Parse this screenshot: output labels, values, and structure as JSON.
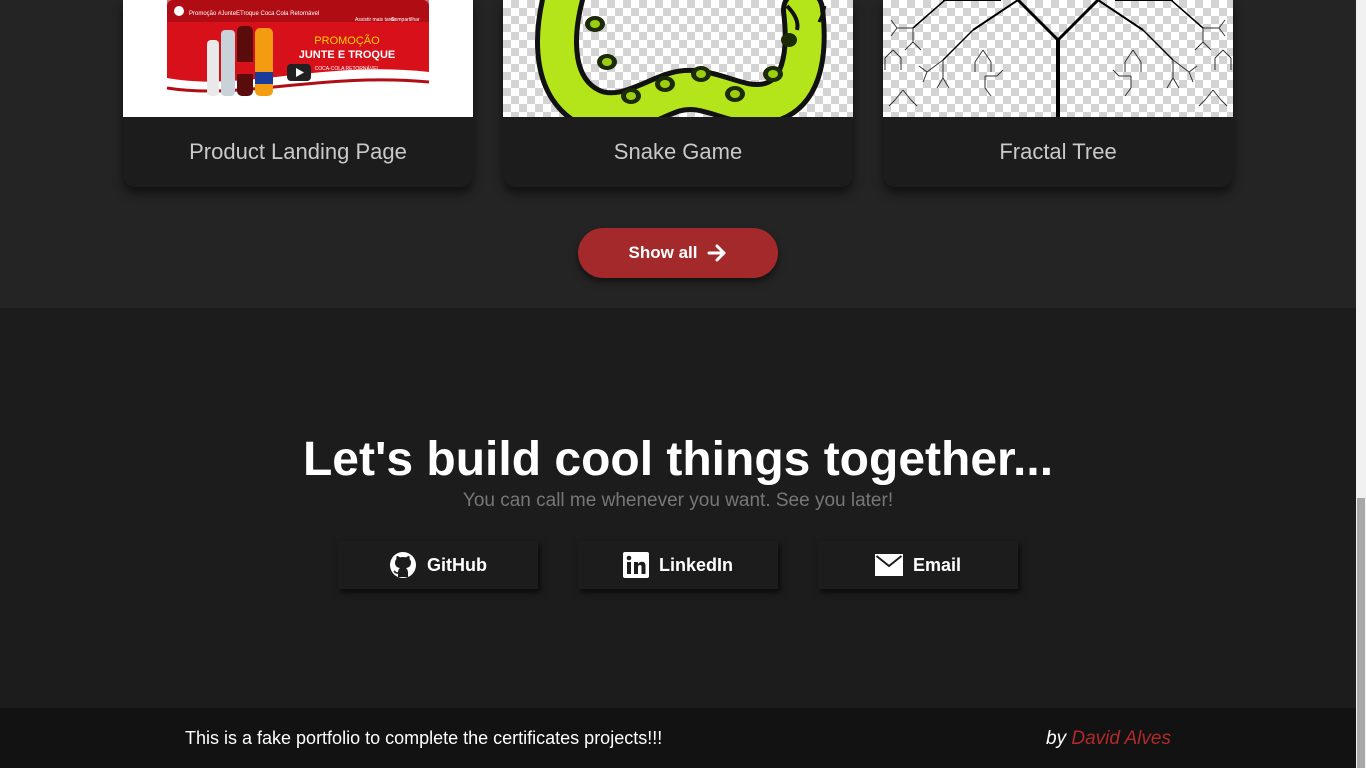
{
  "projects": {
    "cards": [
      {
        "title": "Product Landing Page",
        "thumb_channel": "Promoção #JunteETroque Coca Cola Retornável",
        "thumb_promo": "PROMOÇÃO",
        "thumb_headline": "JUNTE E TROQUE",
        "thumb_tagline": "COCA-COLA RETORNÁVEL",
        "thumb_watch_later": "Assistir mais tarde",
        "thumb_share": "Compartilhar"
      },
      {
        "title": "Snake Game"
      },
      {
        "title": "Fractal Tree"
      }
    ],
    "show_all_label": "Show all"
  },
  "contact": {
    "heading": "Let's build cool things together...",
    "subheading": "You can call me whenever you want. See you later!",
    "links": [
      {
        "label": "GitHub",
        "icon": "github-icon"
      },
      {
        "label": "LinkedIn",
        "icon": "linkedin-icon"
      },
      {
        "label": "Email",
        "icon": "email-icon"
      }
    ]
  },
  "footer": {
    "note": "This is a fake portfolio to complete the certificates projects!!!",
    "by": "by",
    "author": "David Alves"
  },
  "colors": {
    "accent": "#a4292a",
    "page_bg": "#1c1c1c",
    "section_bg": "#242424",
    "footer_bg": "#121212"
  }
}
